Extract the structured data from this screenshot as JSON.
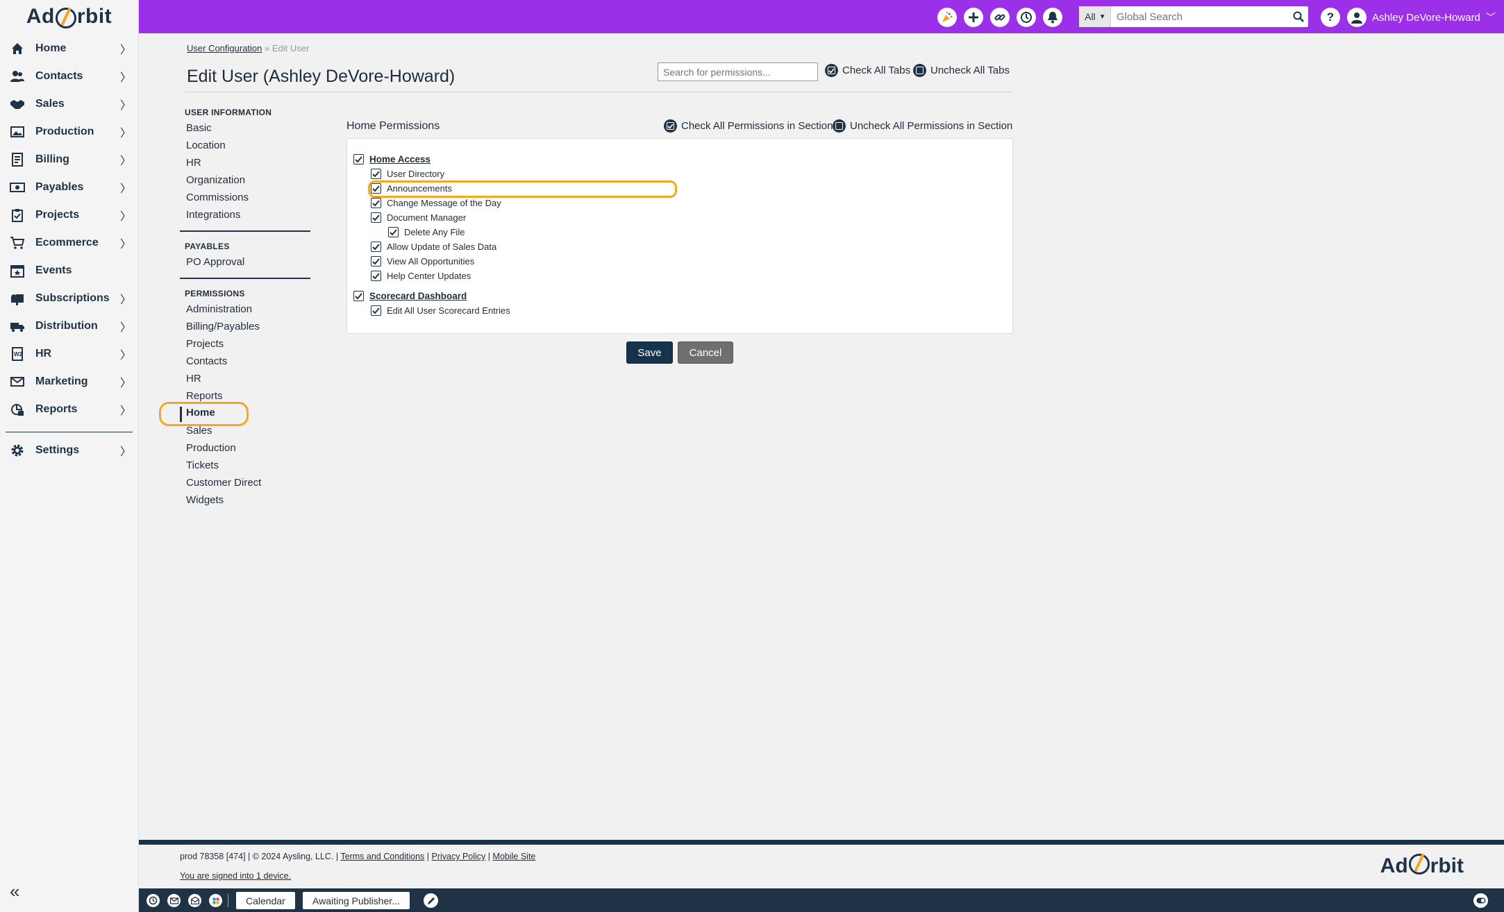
{
  "brand": {
    "logo_left": "Ad",
    "logo_right": "rbit",
    "accent": "#9c2fe8",
    "navy": "#1f3246",
    "highlight": "#f5a623"
  },
  "sidebar": {
    "items": [
      {
        "label": "Home",
        "icon": "home-icon"
      },
      {
        "label": "Contacts",
        "icon": "contacts-icon"
      },
      {
        "label": "Sales",
        "icon": "handshake-icon"
      },
      {
        "label": "Production",
        "icon": "image-icon"
      },
      {
        "label": "Billing",
        "icon": "invoice-icon"
      },
      {
        "label": "Payables",
        "icon": "cash-icon"
      },
      {
        "label": "Projects",
        "icon": "clipboard-icon"
      },
      {
        "label": "Ecommerce",
        "icon": "cart-icon"
      },
      {
        "label": "Events",
        "icon": "calendar-star-icon"
      },
      {
        "label": "Subscriptions",
        "icon": "mailbox-icon"
      },
      {
        "label": "Distribution",
        "icon": "truck-icon"
      },
      {
        "label": "HR",
        "icon": "w2-form-icon"
      },
      {
        "label": "Marketing",
        "icon": "envelope-icon"
      },
      {
        "label": "Reports",
        "icon": "report-icon"
      }
    ],
    "settings": "Settings"
  },
  "topbar": {
    "search_scope": "All",
    "search_placeholder": "Global Search",
    "user_name": "Ashley DeVore-Howard"
  },
  "breadcrumb": {
    "parent": "User Configuration",
    "separator": "»",
    "current": "Edit User"
  },
  "page_title": "Edit User (Ashley DeVore-Howard)",
  "perm_search_placeholder": "Search for permissions...",
  "tab_actions": {
    "check_all": "Check All Tabs",
    "uncheck_all": "Uncheck All Tabs"
  },
  "tabs": {
    "user_info_heading": "USER INFORMATION",
    "user_info": [
      "Basic",
      "Location",
      "HR",
      "Organization",
      "Commissions",
      "Integrations"
    ],
    "payables_heading": "PAYABLES",
    "payables": [
      "PO Approval"
    ],
    "permissions_heading": "PERMISSIONS",
    "permissions": [
      "Administration",
      "Billing/Payables",
      "Projects",
      "Contacts",
      "HR",
      "Reports",
      "Home",
      "Sales",
      "Production",
      "Tickets",
      "Customer Direct",
      "Widgets"
    ],
    "active": "Home"
  },
  "section": {
    "heading": "Home Permissions",
    "check_all": "Check All Permissions in Section",
    "uncheck_all": "Uncheck All Permissions in Section",
    "perms": [
      {
        "label": "Home Access",
        "level": 0,
        "checked": true
      },
      {
        "label": "User Directory",
        "level": 1,
        "checked": true
      },
      {
        "label": "Announcements",
        "level": 1,
        "checked": true
      },
      {
        "label": "Change Message of the Day",
        "level": 1,
        "checked": true
      },
      {
        "label": "Document Manager",
        "level": 1,
        "checked": true
      },
      {
        "label": "Delete Any File",
        "level": 2,
        "checked": true
      },
      {
        "label": "Allow Update of Sales Data",
        "level": 1,
        "checked": true
      },
      {
        "label": "View All Opportunities",
        "level": 1,
        "checked": true
      },
      {
        "label": "Help Center Updates",
        "level": 1,
        "checked": true
      },
      {
        "label": "Scorecard Dashboard",
        "level": 0,
        "checked": true
      },
      {
        "label": "Edit All User Scorecard Entries",
        "level": 1,
        "checked": true
      }
    ]
  },
  "buttons": {
    "save": "Save",
    "cancel": "Cancel"
  },
  "footer": {
    "info": "prod 78358 [474] | © 2024 Aysling, LLC. |",
    "terms": "Terms and Conditions",
    "privacy": "Privacy Policy",
    "mobile": "Mobile Site",
    "sep": "|",
    "signed_in": "You are signed into 1 device."
  },
  "dock": {
    "tab1": "Calendar",
    "tab2": "Awaiting Publisher..."
  }
}
